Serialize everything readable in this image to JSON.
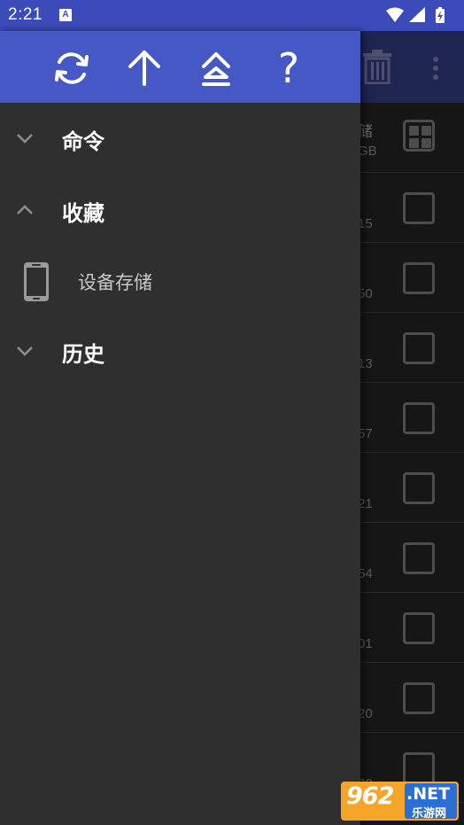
{
  "status_bar": {
    "time": "2:21",
    "notification_icon": "a-icon",
    "icons": [
      "wifi-icon",
      "signal-icon",
      "battery-charging-icon"
    ]
  },
  "background": {
    "toolbar_icons": [
      "trash-icon",
      "more-vert-icon"
    ],
    "rows": [
      {
        "text": "储\nGB",
        "control": "grid-icon"
      },
      {
        "text": "15",
        "control": "checkbox"
      },
      {
        "text": "50",
        "control": "checkbox"
      },
      {
        "text": "13",
        "control": "checkbox"
      },
      {
        "text": "57",
        "control": "checkbox"
      },
      {
        "text": "21",
        "control": "checkbox"
      },
      {
        "text": "54",
        "control": "checkbox"
      },
      {
        "text": "01",
        "control": "checkbox"
      },
      {
        "text": "20",
        "control": "checkbox"
      },
      {
        "text": "20",
        "control": "checkbox"
      }
    ]
  },
  "drawer": {
    "toolbar": {
      "buttons": [
        "refresh-icon",
        "arrow-up-icon",
        "collapse-all-icon",
        "help-icon"
      ],
      "help_label": "?"
    },
    "groups": [
      {
        "label": "命令",
        "expanded": false,
        "items": []
      },
      {
        "label": "收藏",
        "expanded": true,
        "items": [
          {
            "label": "设备存储",
            "icon": "phone-icon"
          }
        ]
      },
      {
        "label": "历史",
        "expanded": false,
        "items": []
      }
    ]
  },
  "watermark": {
    "number": "962",
    "suffix": ".NET",
    "site": "乐游网"
  },
  "colors": {
    "status_bar": "#3b4cba",
    "drawer_toolbar": "#4558c6",
    "drawer_bg": "#2f2f2f",
    "background_list": "#161616"
  }
}
